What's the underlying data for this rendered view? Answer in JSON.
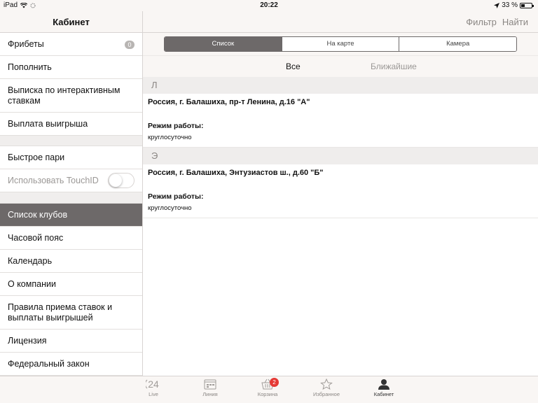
{
  "status_bar": {
    "device": "iPad",
    "time": "20:22",
    "battery": "33 %",
    "battery_level": 0.33
  },
  "left_nav": {
    "title": "Кабинет"
  },
  "right_nav": {
    "filter_label": "Фильтр",
    "search_label": "Найти"
  },
  "sidebar": {
    "group1": [
      {
        "label": "Фрибеты",
        "badge": "0"
      },
      {
        "label": "Пополнить"
      },
      {
        "label": "Выписка по интерактивным ставкам"
      },
      {
        "label": "Выплата выигрыша"
      }
    ],
    "group2": [
      {
        "label": "Быстрое пари"
      },
      {
        "label": "Использовать TouchID",
        "toggle": false
      }
    ],
    "group3": [
      {
        "label": "Список клубов",
        "active": true
      },
      {
        "label": "Часовой пояс"
      },
      {
        "label": "Календарь"
      },
      {
        "label": "О компании"
      },
      {
        "label": "Правила приема ставок и выплаты выигрышей"
      },
      {
        "label": "Лицензия"
      },
      {
        "label": "Федеральный закон"
      }
    ]
  },
  "segments": [
    "Список",
    "На карте",
    "Камера"
  ],
  "active_segment": 0,
  "filter_tabs": {
    "all": "Все",
    "nearest": "Ближайшие"
  },
  "sections": [
    {
      "letter": "Л",
      "clubs": [
        {
          "address": "Россия, г. Балашиха, пр-т Ленина, д.16 \"А\"",
          "hours_label": "Режим работы:",
          "hours": "круглосуточно"
        }
      ]
    },
    {
      "letter": "Э",
      "clubs": [
        {
          "address": "Россия, г. Балашиха, Энтузиастов ш., д.60 \"Б\"",
          "hours_label": "Режим работы:",
          "hours": "круглосуточно"
        }
      ]
    }
  ],
  "tab_bar": {
    "items": [
      {
        "label": "Live",
        "icon": "live-icon"
      },
      {
        "label": "Линия",
        "icon": "calendar-icon"
      },
      {
        "label": "Корзина",
        "icon": "basket-icon",
        "badge": "2"
      },
      {
        "label": "Избранное",
        "icon": "star-icon"
      },
      {
        "label": "Кабинет",
        "icon": "person-icon",
        "active": true
      }
    ]
  },
  "colors": {
    "accent_gray": "#6d6969",
    "badge_red": "#e53935",
    "bar_bg": "#f9f6f4"
  }
}
